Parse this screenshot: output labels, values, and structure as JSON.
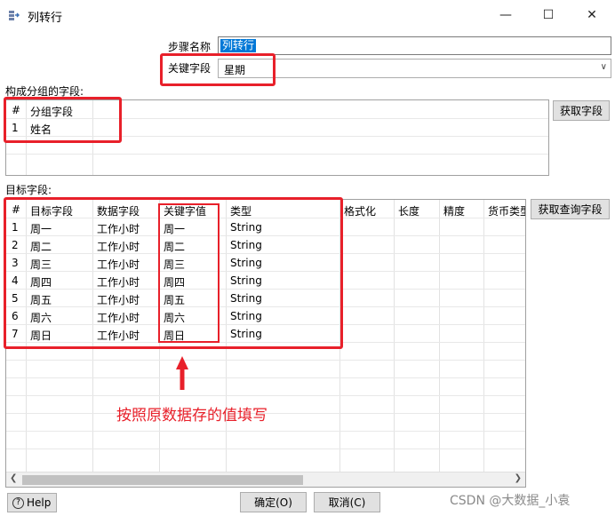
{
  "window": {
    "title": "列转行",
    "minimize_glyph": "—",
    "maximize_glyph": "☐",
    "close_glyph": "✕"
  },
  "form": {
    "step_name_label": "步骤名称",
    "step_name_value": "列转行",
    "key_field_label": "关键字段",
    "key_field_value": "星期"
  },
  "group_section": {
    "label": "构成分组的字段:",
    "columns": [
      "#",
      "分组字段"
    ],
    "rows": [
      [
        "1",
        "姓名"
      ]
    ],
    "get_fields_button": "获取字段"
  },
  "target_section": {
    "label": "目标字段:",
    "columns": [
      "#",
      "目标字段",
      "数据字段",
      "关键字值",
      "类型",
      "格式化",
      "长度",
      "精度",
      "货币类型"
    ],
    "rows": [
      [
        "1",
        "周一",
        "工作小时",
        "周一",
        "String"
      ],
      [
        "2",
        "周二",
        "工作小时",
        "周二",
        "String"
      ],
      [
        "3",
        "周三",
        "工作小时",
        "周三",
        "String"
      ],
      [
        "4",
        "周四",
        "工作小时",
        "周四",
        "String"
      ],
      [
        "5",
        "周五",
        "工作小时",
        "周五",
        "String"
      ],
      [
        "6",
        "周六",
        "工作小时",
        "周六",
        "String"
      ],
      [
        "7",
        "周日",
        "工作小时",
        "周日",
        "String"
      ]
    ],
    "get_lookup_fields_button": "获取查询字段"
  },
  "annotation": {
    "text": "按照原数据存的值填写",
    "color": "#e8202a"
  },
  "footer": {
    "help_button": "Help",
    "ok_button": "确定(O)",
    "cancel_button": "取消(C)"
  },
  "watermark": "CSDN @大数据_小袁"
}
